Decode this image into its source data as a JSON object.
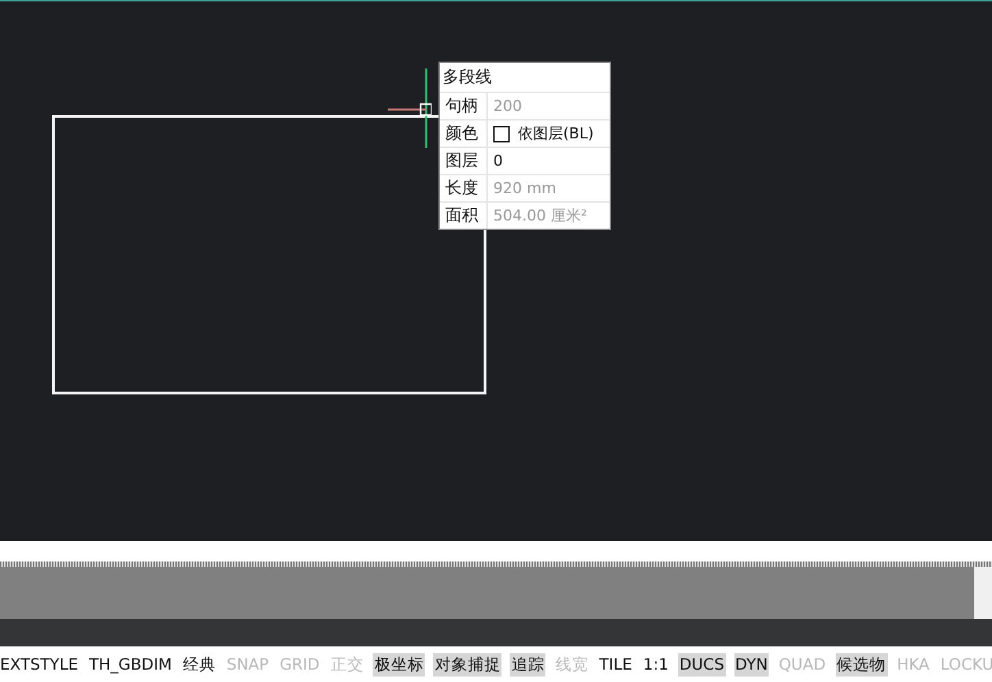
{
  "tooltip": {
    "title": "多段线",
    "rows": [
      {
        "label": "句柄",
        "kind": "text",
        "value": "200",
        "readonly": true
      },
      {
        "label": "颜色",
        "kind": "color",
        "value": "依图层(BL)",
        "readonly": false,
        "color": "#ffffff"
      },
      {
        "label": "图层",
        "kind": "text",
        "value": "0",
        "readonly": false
      },
      {
        "label": "长度",
        "kind": "text",
        "value": "920 mm",
        "readonly": true
      },
      {
        "label": "面积",
        "kind": "text",
        "value": "504.00 厘米²",
        "readonly": true
      }
    ]
  },
  "status_bar": [
    {
      "label": "EXTSTYLE",
      "kind": "text"
    },
    {
      "label": "TH_GBDIM",
      "kind": "text"
    },
    {
      "label": "经典",
      "kind": "text"
    },
    {
      "label": "SNAP",
      "kind": "toggle",
      "on": false
    },
    {
      "label": "GRID",
      "kind": "toggle",
      "on": false
    },
    {
      "label": "正交",
      "kind": "toggle",
      "on": false
    },
    {
      "label": "极坐标",
      "kind": "toggle",
      "on": true
    },
    {
      "label": "对象捕捉",
      "kind": "toggle",
      "on": true
    },
    {
      "label": "追踪",
      "kind": "toggle",
      "on": true
    },
    {
      "label": "线宽",
      "kind": "toggle",
      "on": false
    },
    {
      "label": "TILE",
      "kind": "text"
    },
    {
      "label": "1:1",
      "kind": "text"
    },
    {
      "label": "DUCS",
      "kind": "toggle",
      "on": true
    },
    {
      "label": "DYN",
      "kind": "toggle",
      "on": true
    },
    {
      "label": "QUAD",
      "kind": "toggle",
      "on": false
    },
    {
      "label": "候选物",
      "kind": "toggle",
      "on": true
    },
    {
      "label": "HKA",
      "kind": "toggle",
      "on": false
    },
    {
      "label": "LOCKU",
      "kind": "toggle",
      "on": false
    }
  ]
}
